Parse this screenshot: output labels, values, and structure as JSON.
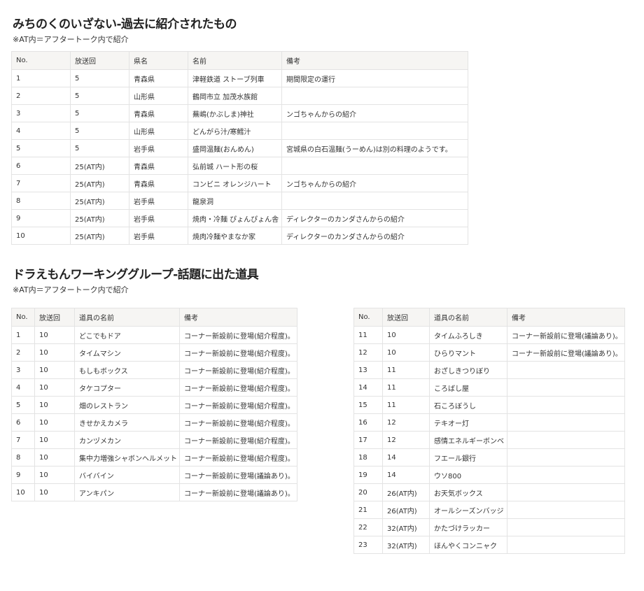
{
  "section1": {
    "title": "みちのくのいざない-過去に紹介されたもの",
    "note": "※AT内＝アフタートーク内で紹介",
    "headers": [
      "No.",
      "放送回",
      "県名",
      "名前",
      "備考"
    ],
    "rows": [
      [
        "1",
        "5",
        "青森県",
        "津軽鉄道 ストーブ列車",
        "期間限定の運行"
      ],
      [
        "2",
        "5",
        "山形県",
        "鶴岡市立 加茂水族館",
        ""
      ],
      [
        "3",
        "5",
        "青森県",
        "蕪嶋(かぶしま)神社",
        "ンゴちゃんからの紹介"
      ],
      [
        "4",
        "5",
        "山形県",
        "どんがら汁/寒鱈汁",
        ""
      ],
      [
        "5",
        "5",
        "岩手県",
        "盛岡温麺(おんめん)",
        "宮城県の白石温麺(うーめん)は別の料理のようです。"
      ],
      [
        "6",
        "25(AT内)",
        "青森県",
        "弘前城 ハート形の桜",
        ""
      ],
      [
        "7",
        "25(AT内)",
        "青森県",
        "コンビニ オレンジハート",
        "ンゴちゃんからの紹介"
      ],
      [
        "8",
        "25(AT内)",
        "岩手県",
        "龍泉洞",
        ""
      ],
      [
        "9",
        "25(AT内)",
        "岩手県",
        "焼肉・冷麺 ぴょんぴょん舎",
        "ディレクターのカンダさんからの紹介"
      ],
      [
        "10",
        "25(AT内)",
        "岩手県",
        "焼肉冷麺やまなか家",
        "ディレクターのカンダさんからの紹介"
      ]
    ]
  },
  "section2": {
    "title": "ドラえもんワーキンググループ-話題に出た道具",
    "note": "※AT内＝アフタートーク内で紹介",
    "headers": [
      "No.",
      "放送回",
      "道具の名前",
      "備考"
    ],
    "left_rows": [
      [
        "1",
        "10",
        "どこでもドア",
        "コーナー新設前に登場(紹介程度)。"
      ],
      [
        "2",
        "10",
        "タイムマシン",
        "コーナー新設前に登場(紹介程度)。"
      ],
      [
        "3",
        "10",
        "もしもボックス",
        "コーナー新設前に登場(紹介程度)。"
      ],
      [
        "4",
        "10",
        "タケコプター",
        "コーナー新設前に登場(紹介程度)。"
      ],
      [
        "5",
        "10",
        "畑のレストラン",
        "コーナー新設前に登場(紹介程度)。"
      ],
      [
        "6",
        "10",
        "きせかえカメラ",
        "コーナー新設前に登場(紹介程度)。"
      ],
      [
        "7",
        "10",
        "カンヅメカン",
        "コーナー新設前に登場(紹介程度)。"
      ],
      [
        "8",
        "10",
        "集中力増強シャボンヘルメット",
        "コーナー新設前に登場(紹介程度)。"
      ],
      [
        "9",
        "10",
        "バイバイン",
        "コーナー新設前に登場(議論あり)。"
      ],
      [
        "10",
        "10",
        "アンキパン",
        "コーナー新設前に登場(議論あり)。"
      ]
    ],
    "right_rows": [
      [
        "11",
        "10",
        "タイムふろしき",
        "コーナー新設前に登場(議論あり)。"
      ],
      [
        "12",
        "10",
        "ひらりマント",
        "コーナー新設前に登場(議論あり)。"
      ],
      [
        "13",
        "11",
        "おざしきつりぼり",
        ""
      ],
      [
        "14",
        "11",
        "ころばし屋",
        ""
      ],
      [
        "15",
        "11",
        "石ころぼうし",
        ""
      ],
      [
        "16",
        "12",
        "テキオー灯",
        ""
      ],
      [
        "17",
        "12",
        "感情エネルギーボンベ",
        ""
      ],
      [
        "18",
        "14",
        "フエール銀行",
        ""
      ],
      [
        "19",
        "14",
        "ウソ800",
        ""
      ],
      [
        "20",
        "26(AT内)",
        "お天気ボックス",
        ""
      ],
      [
        "21",
        "26(AT内)",
        "オールシーズンバッジ",
        ""
      ],
      [
        "22",
        "32(AT内)",
        "かたづけラッカー",
        ""
      ],
      [
        "23",
        "32(AT内)",
        "ほんやくコンニャク",
        ""
      ]
    ]
  }
}
